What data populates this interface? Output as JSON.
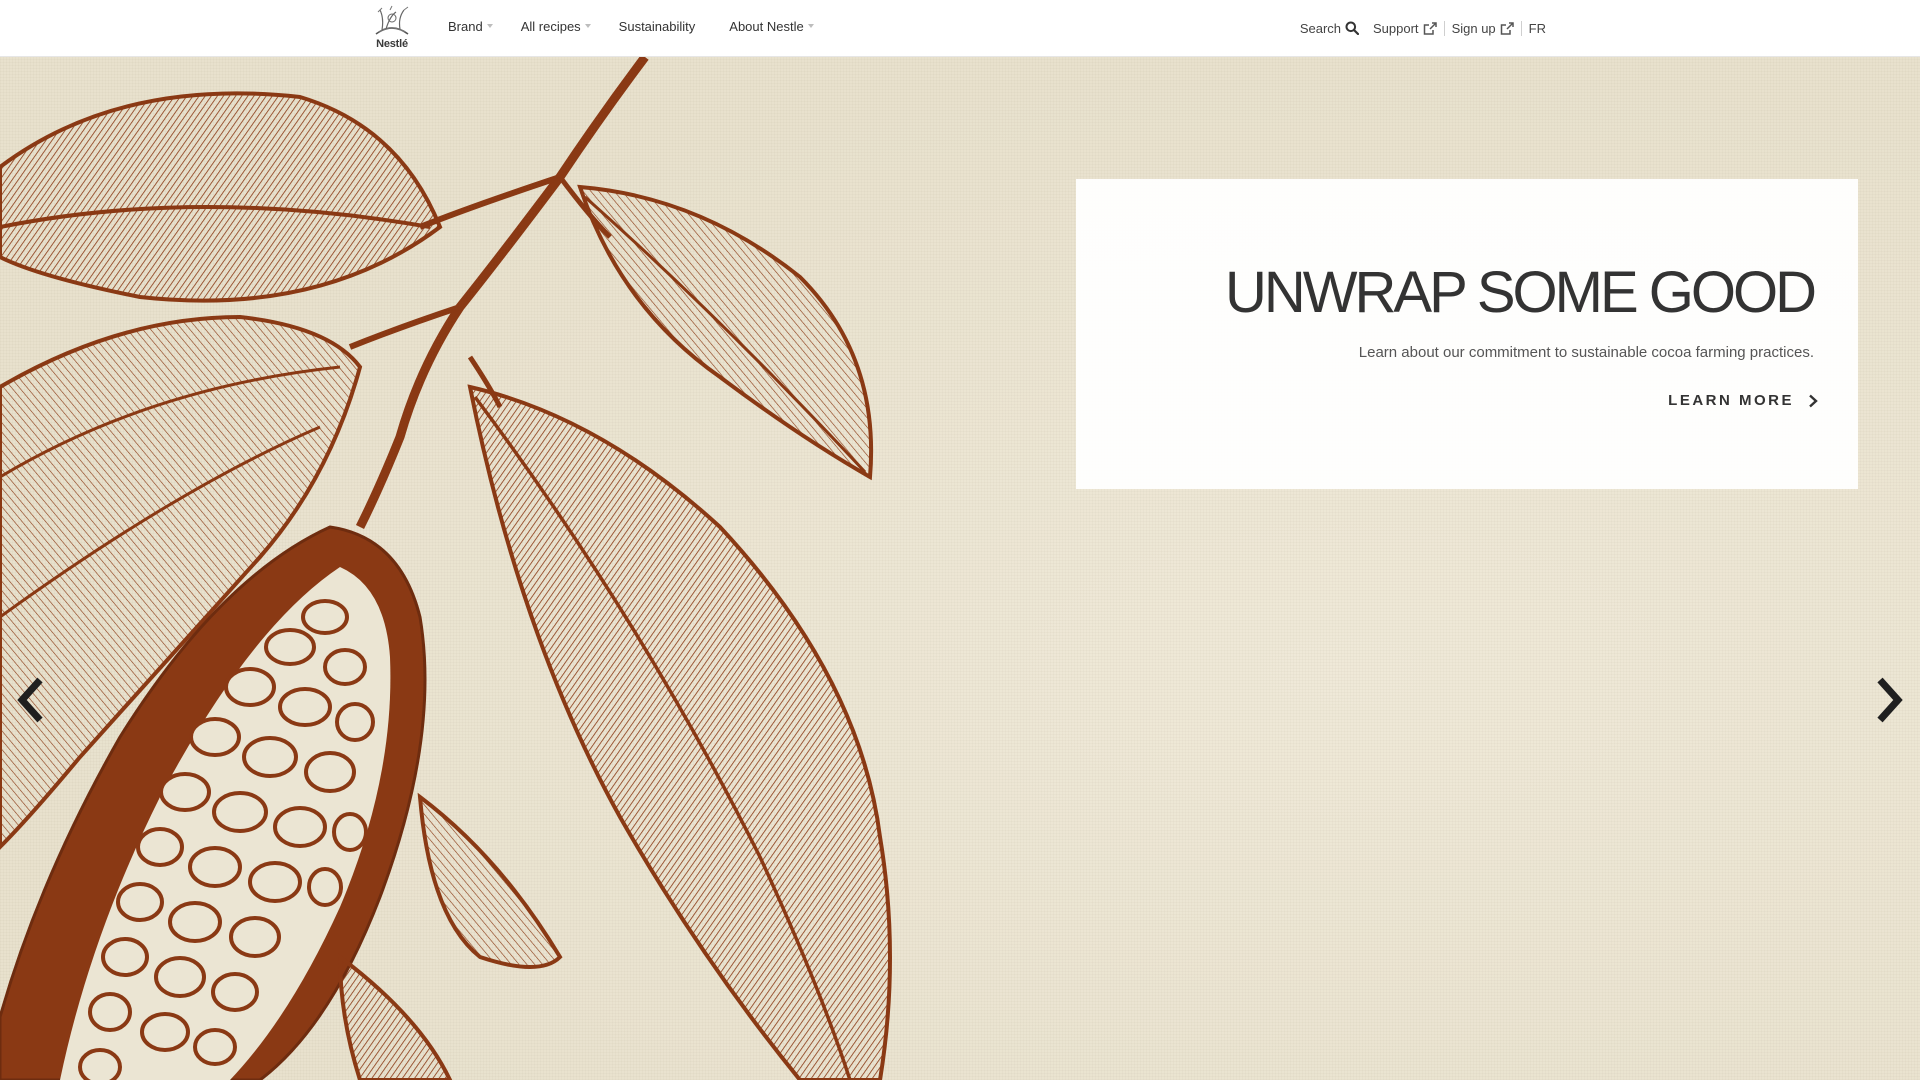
{
  "header": {
    "logo_text": "Nestlé",
    "nav": [
      {
        "label": "Brand",
        "has_dropdown": true
      },
      {
        "label": "All recipes",
        "has_dropdown": true
      },
      {
        "label": "Sustainability",
        "has_dropdown": false
      },
      {
        "label": "About Nestle",
        "has_dropdown": true
      }
    ],
    "utility": {
      "search_label": "Search",
      "search_icon": "search-icon",
      "support_label": "Support",
      "support_icon": "external-link-icon",
      "signup_label": "Sign up",
      "signup_icon": "external-link-icon",
      "language_label": "FR"
    }
  },
  "hero": {
    "title": "UNWRAP SOME GOOD",
    "description": "Learn about our commitment to sustainable cocoa farming practices.",
    "cta_label": "LEARN MORE",
    "cta_icon": "chevron-right-icon",
    "prev_icon": "chevron-left-icon",
    "next_icon": "chevron-right-icon",
    "illustration": "cocoa-pod-illustration"
  },
  "colors": {
    "illustration": "#8a3914",
    "background": "#ebe5d3",
    "text": "#333333"
  }
}
